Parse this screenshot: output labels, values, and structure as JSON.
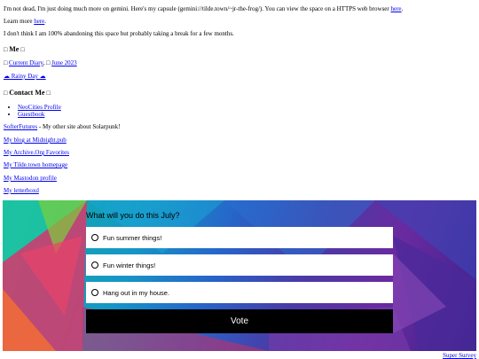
{
  "intro": {
    "text_before": "I'm not dead, I'm just doing much more on gemini. Here's my capsule (gemini://tilde.town/~jr-the-frog/). You can view the space on a HTTPS web browser ",
    "link": "here",
    "text_after": "."
  },
  "learn_more": {
    "text": "Learn more ",
    "link": "here",
    "after": "."
  },
  "status_line": "I don't think I am 100% abandoning this space but probably taking a break for a few months.",
  "me": {
    "heading": "Me",
    "links": [
      "Current Diary",
      "June 2023"
    ],
    "separator": ", ",
    "rainy": "☁ Rainy Day ☁"
  },
  "contact": {
    "heading": "Contact Me",
    "list": [
      "NeoCities Profile",
      "Guestbook"
    ]
  },
  "softer": {
    "link": "SofterFutures",
    "rest": " - My other site about Solarpunk!"
  },
  "links": [
    "My blog at Midnight.pub",
    "My Archive.Org Favorites",
    "My Tilde.town homepage",
    "My Mastodon profile",
    "My letterboxd"
  ],
  "survey": {
    "question": "What will you do this July?",
    "options": [
      "Fun summer things!",
      "Fun winter things!",
      "Hang out in my house."
    ],
    "vote_label": "Vote",
    "credit": "Super Survey"
  },
  "icons": {
    "box": "□",
    "radio": "radio-circle-icon"
  },
  "colors": {
    "link": "#0000ee",
    "vote_bg": "#000000"
  }
}
